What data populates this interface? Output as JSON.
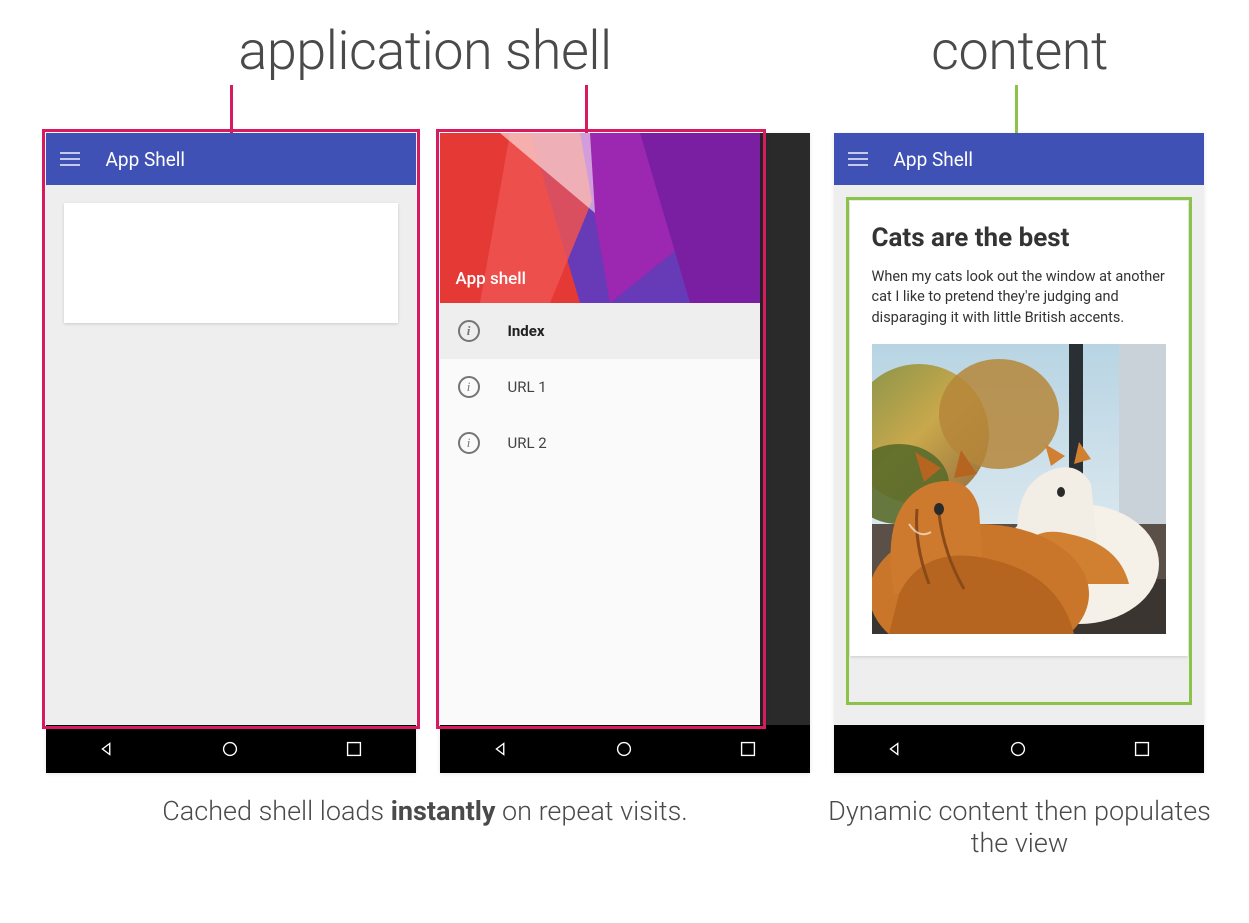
{
  "headings": {
    "app_shell": "application shell",
    "content": "content"
  },
  "colors": {
    "pink": "#d81b60",
    "green": "#8bc34a",
    "primary": "#3F51B5"
  },
  "phone1": {
    "app_title": "App Shell"
  },
  "phone2": {
    "drawer_title": "App shell",
    "items": [
      {
        "label": "Index",
        "active": true
      },
      {
        "label": "URL 1",
        "active": false
      },
      {
        "label": "URL 2",
        "active": false
      }
    ]
  },
  "phone3": {
    "app_title": "App Shell",
    "article_title": "Cats are the best",
    "article_body": "When my cats look out the window at another cat I like to pretend they're judging and disparaging it with little British accents."
  },
  "captions": {
    "left_pre": "Cached shell loads ",
    "left_bold": "instantly",
    "left_post": " on repeat visits.",
    "right": "Dynamic content then populates the view"
  }
}
